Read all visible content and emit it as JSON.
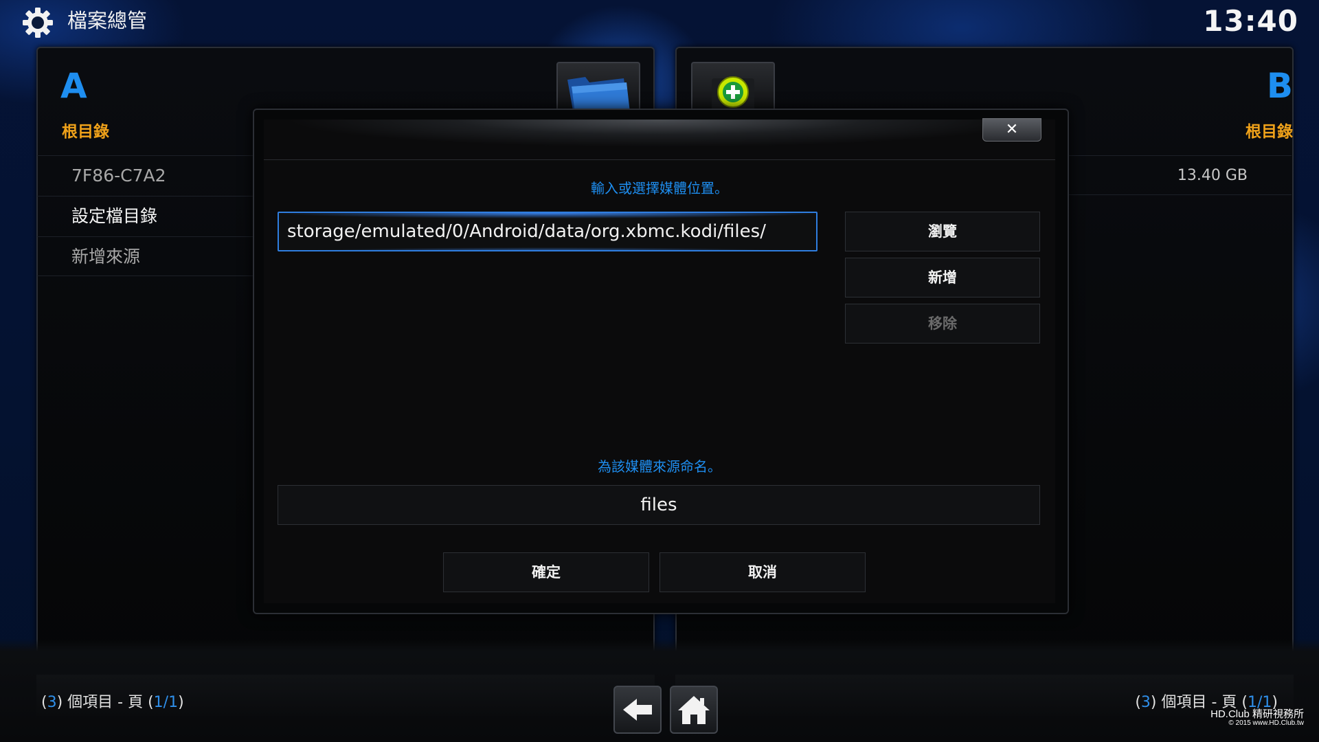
{
  "header": {
    "title": "檔案總管",
    "clock": "13:40",
    "icon": "gear-icon"
  },
  "left_panel": {
    "letter": "A",
    "subtitle": "根目錄",
    "items": [
      {
        "label": "7F86-C7A2"
      },
      {
        "label": "設定檔目錄"
      },
      {
        "label": "新增來源"
      }
    ],
    "footer": {
      "open": "(",
      "count": "3",
      "mid": ") 個項目 - 頁 (",
      "page": "1/1",
      "close": ")"
    }
  },
  "right_panel": {
    "letter": "B",
    "subtitle": "根目錄",
    "items": [
      {
        "size": "13.40 GB"
      }
    ],
    "footer": {
      "open": "(",
      "count": "3",
      "mid": ") 個項目 - 頁 (",
      "page": "1/1",
      "close": ")"
    }
  },
  "tiles": {
    "folder_icon": "folder-icon",
    "add_icon": "add-circle-icon"
  },
  "dialog": {
    "close_label": "✕",
    "location_prompt": "輸入或選擇媒體位置。",
    "path_value": "storage/emulated/0/Android/data/org.xbmc.kodi/files/",
    "browse_label": "瀏覽",
    "add_label": "新增",
    "remove_label": "移除",
    "name_prompt": "為該媒體來源命名。",
    "name_value": "files",
    "ok_label": "確定",
    "cancel_label": "取消"
  },
  "nav": {
    "back_icon": "back-arrow-icon",
    "home_icon": "home-icon"
  },
  "watermark": {
    "line1": "HD.Club 精研視務所",
    "line2": "© 2015  www.HD.Club.tw"
  },
  "colors": {
    "accent_blue": "#1e8ef0",
    "accent_orange": "#f0a21a",
    "background": "#041231"
  }
}
